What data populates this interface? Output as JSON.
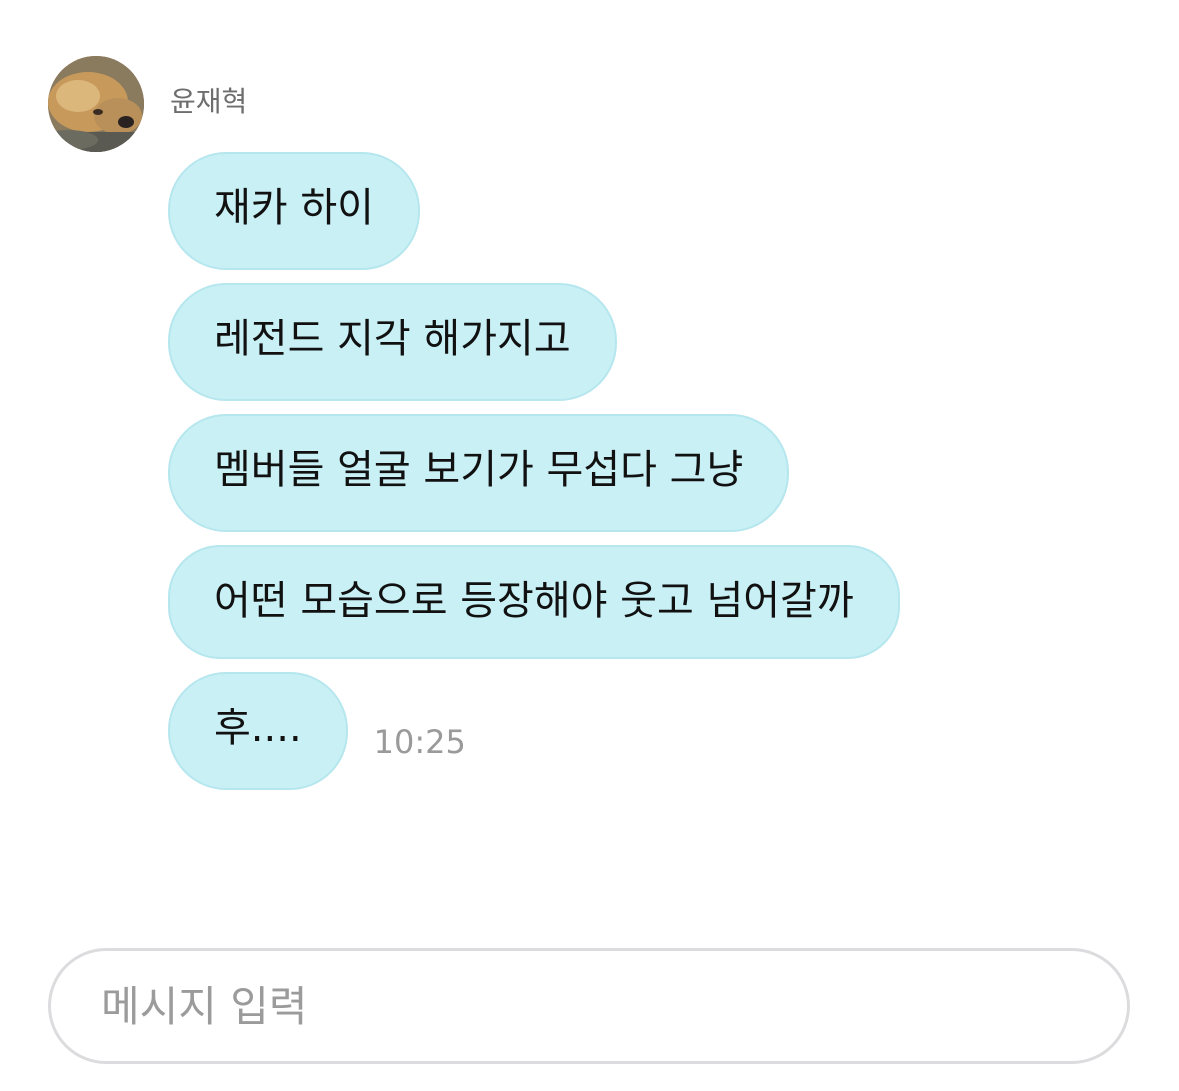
{
  "chat": {
    "sender": {
      "name": "윤재혁",
      "avatar_icon": "dog-photo-avatar"
    },
    "messages": [
      {
        "text": "재카 하이"
      },
      {
        "text": "레전드 지각 해가지고"
      },
      {
        "text": "멤버들 얼굴 보기가 무섭다 그냥"
      },
      {
        "text": "어떤 모습으로 등장해야 웃고 넘어갈까"
      },
      {
        "text": "후....",
        "timestamp": "10:25"
      }
    ]
  },
  "composer": {
    "placeholder": "메시지 입력"
  },
  "colors": {
    "bubble_background": "#c8f0f5",
    "bubble_border": "#b6e6ee",
    "timestamp": "#9a9a9a",
    "placeholder": "#9b9b9b"
  }
}
